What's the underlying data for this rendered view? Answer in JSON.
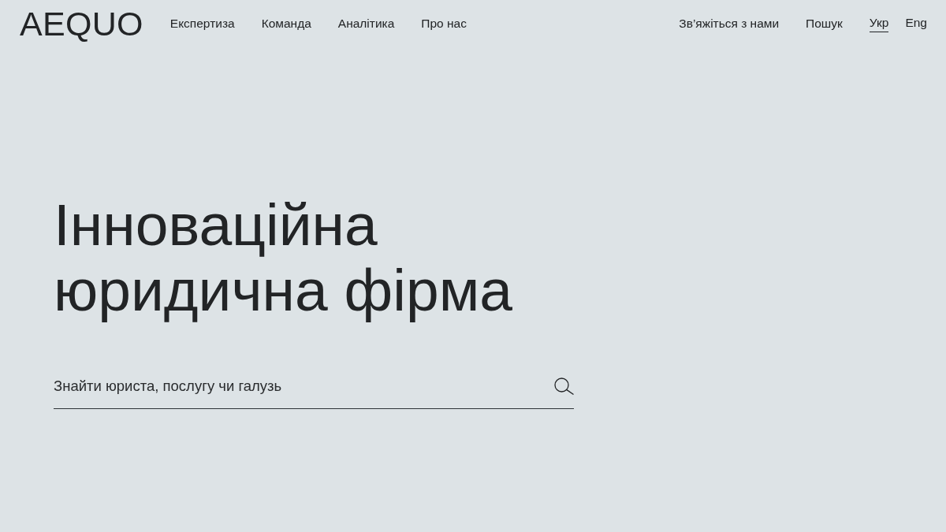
{
  "header": {
    "logo": "AEQUO",
    "nav": [
      {
        "label": "Експертиза"
      },
      {
        "label": "Команда"
      },
      {
        "label": "Аналітика"
      },
      {
        "label": "Про нас"
      }
    ],
    "utility_links": [
      {
        "label": "Зв’яжіться з нами"
      },
      {
        "label": "Пошук"
      }
    ],
    "languages": [
      {
        "label": "Укр",
        "selected": true
      },
      {
        "label": "Eng",
        "selected": false
      }
    ]
  },
  "hero": {
    "title_lines": [
      "Інноваційна",
      "юридична фірма"
    ],
    "search": {
      "placeholder": "Знайти юриста, послугу чи галузь"
    }
  }
}
